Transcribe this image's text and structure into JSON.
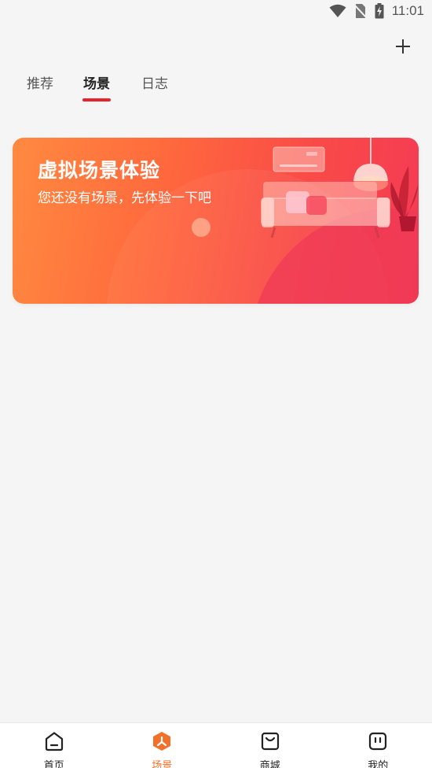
{
  "status_bar": {
    "time": "11:01",
    "icons": [
      "wifi-icon",
      "no-sim-icon",
      "battery-charging-icon"
    ]
  },
  "header": {
    "add_icon": "plus-icon"
  },
  "tabs": [
    {
      "label": "推荐",
      "active": false
    },
    {
      "label": "场景",
      "active": true
    },
    {
      "label": "日志",
      "active": false
    }
  ],
  "banner": {
    "title": "虚拟场景体验",
    "subtitle": "您还没有场景，先体验一下吧",
    "illustration": "living-room-illustration"
  },
  "bottom_nav": [
    {
      "label": "首页",
      "icon": "home-icon",
      "active": false
    },
    {
      "label": "场景",
      "icon": "scene-hex-icon",
      "active": true
    },
    {
      "label": "商城",
      "icon": "shop-bag-icon",
      "active": false
    },
    {
      "label": "我的",
      "icon": "profile-face-icon",
      "active": false
    }
  ],
  "colors": {
    "accent": "#e8232c",
    "nav_active": "#f2712a",
    "banner_start": "#ff8a40",
    "banner_end": "#f53a55"
  }
}
